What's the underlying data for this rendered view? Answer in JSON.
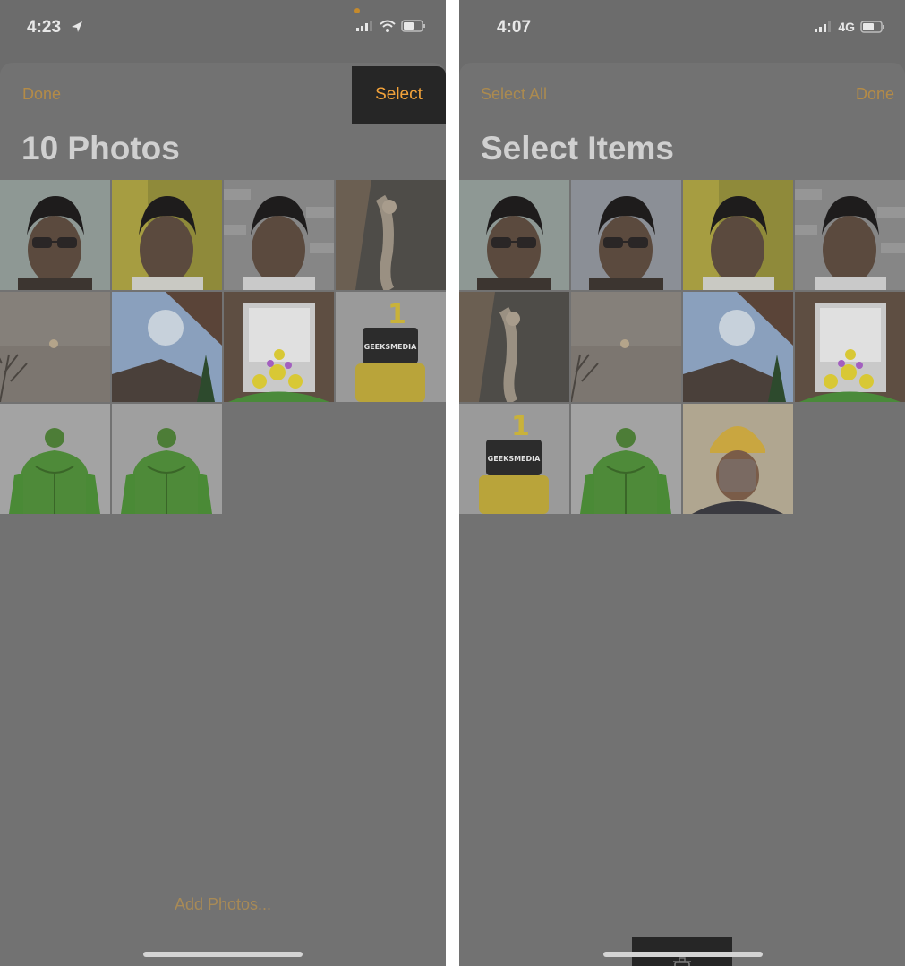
{
  "left_screen": {
    "status": {
      "time": "4:23"
    },
    "nav": {
      "done_label": "Done",
      "select_label": "Select"
    },
    "title": "10 Photos",
    "add_photos_label": "Add Photos..."
  },
  "right_screen": {
    "status": {
      "time": "4:07",
      "network": "4G"
    },
    "nav": {
      "select_all_label": "Select All",
      "done_label": "Done"
    },
    "title": "Select Items",
    "toolbar": {
      "trash_icon": "trash-icon"
    }
  },
  "colors": {
    "accent": "#f2a23a",
    "dimmed_accent": "#b48b47",
    "overlay_bg": "#6c6c6c",
    "highlight_box": "#262626"
  },
  "cake_topper_text": "GEEKSMEDIA"
}
